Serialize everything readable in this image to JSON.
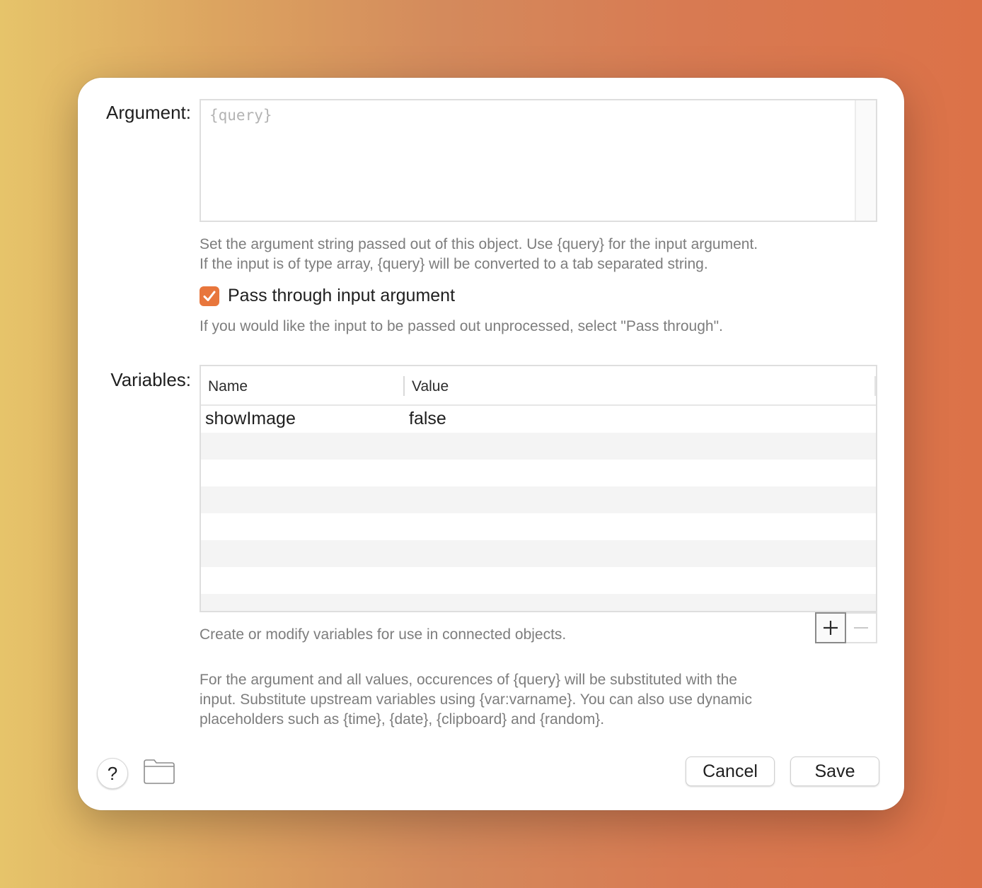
{
  "argument": {
    "label": "Argument:",
    "placeholder": "{query}",
    "help_line1": "Set the argument string passed out of this object. Use {query} for the input argument.",
    "help_line2": "If the input is of type array, {query} will be converted to a tab separated string."
  },
  "pass_through": {
    "label": "Pass through input argument",
    "checked": true,
    "help": "If you would like the input to be passed out unprocessed, select \"Pass through\"."
  },
  "variables": {
    "label": "Variables:",
    "columns": [
      "Name",
      "Value"
    ],
    "rows": [
      {
        "name": "showImage",
        "value": "false"
      }
    ],
    "add_icon": "plus-icon",
    "remove_icon": "minus-icon",
    "help": "Create or modify variables for use in connected objects."
  },
  "footer_note": {
    "line1": "For the argument and all values, occurences of {query} will be substituted with the",
    "line2": "input. Substitute upstream variables using {var:varname}. You can also use dynamic",
    "line3": "placeholders such as {time}, {date}, {clipboard} and {random}."
  },
  "buttons": {
    "help": "?",
    "cancel": "Cancel",
    "save": "Save"
  },
  "colors": {
    "accent": "#e8763c"
  }
}
